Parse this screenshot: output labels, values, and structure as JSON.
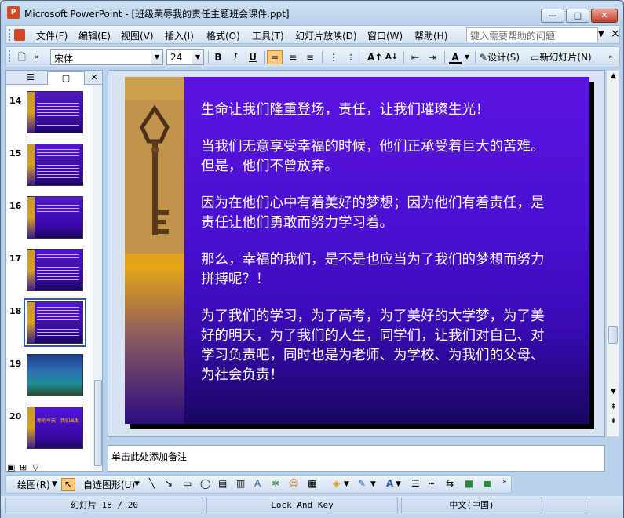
{
  "window": {
    "title": "Microsoft PowerPoint - [班级荣辱我的责任主题班会课件.ppt]",
    "app_icon_label": "P",
    "controls": {
      "minimize": "—",
      "maximize": "□",
      "close": "✕"
    }
  },
  "menu": {
    "items": [
      "文件(F)",
      "编辑(E)",
      "视图(V)",
      "插入(I)",
      "格式(O)",
      "工具(T)",
      "幻灯片放映(D)",
      "窗口(W)",
      "帮助(H)"
    ],
    "help_placeholder": "键入需要帮助的问题",
    "close_glyph": "×"
  },
  "toolbar": {
    "font_name": "宋体",
    "font_size": "24",
    "bold": "B",
    "italic": "I",
    "underline": "U",
    "font_color_glyph": "A",
    "design_label": "设计(S)",
    "new_slide_label": "新幻灯片(N)"
  },
  "slides_panel": {
    "thumbnails": [
      {
        "number": "14"
      },
      {
        "number": "15"
      },
      {
        "number": "16"
      },
      {
        "number": "17"
      },
      {
        "number": "18"
      },
      {
        "number": "19"
      },
      {
        "number": "20"
      }
    ],
    "selected": "18",
    "thumb20_text": "新的今天，我们出发"
  },
  "slide": {
    "paragraphs": [
      "生命让我们隆重登场，责任，让我们璀璨生光！",
      "当我们无意享受幸福的时候，他们正承受着巨大的苦难。但是，他们不曾放弃。",
      "因为在他们心中有着美好的梦想；因为他们有着责任，是责任让他们勇敢而努力学习着。",
      "那么，幸福的我们，是不是也应当为了我们的梦想而努力拼搏呢？！",
      "为了我们的学习，为了高考，为了美好的大学梦，为了美好的明天，为了我们的人生，同学们，让我们对自己、对学习负责吧，同时也是为老师、为学校、为我们的父母、为社会负责！"
    ]
  },
  "notes": {
    "placeholder": "单击此处添加备注"
  },
  "drawbar": {
    "draw_label": "绘图(R)",
    "autoshapes_label": "自选图形(U)"
  },
  "status": {
    "slide_position": "幻灯片 18 / 20",
    "theme": "Lock And Key",
    "language": "中文(中国)"
  },
  "colors": {
    "slide_bg": "#4a0fd0",
    "slide_strip": "#e0a020",
    "selected_tool": "#ffc77a"
  }
}
